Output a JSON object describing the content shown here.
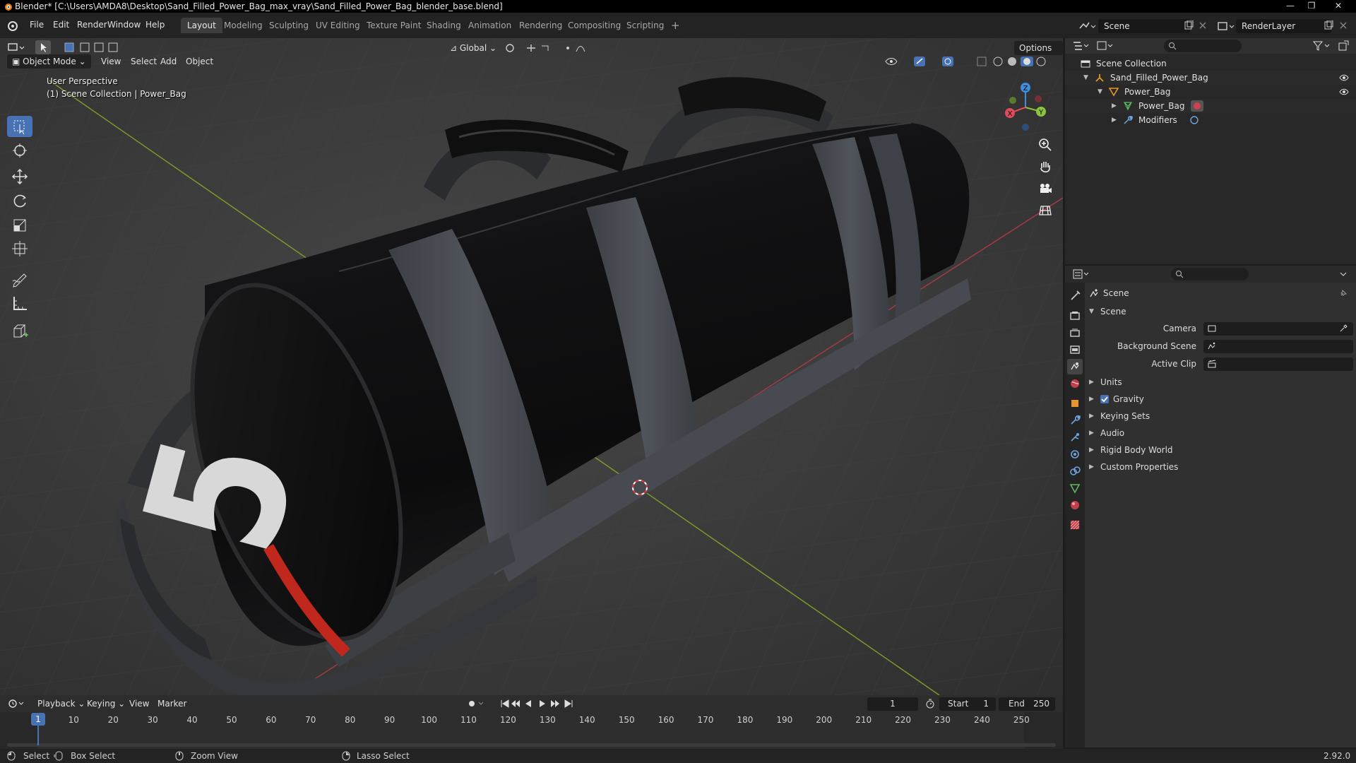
{
  "window": {
    "title": "Blender* [C:\\Users\\AMDA8\\Desktop\\Sand_Filled_Power_Bag_max_vray\\Sand_Filled_Power_Bag_blender_base.blend]",
    "minimize": "—",
    "maximize": "❐",
    "close": "✕"
  },
  "menu": [
    "File",
    "Edit",
    "Render",
    "Window",
    "Help"
  ],
  "workspaces": [
    {
      "label": "Layout",
      "active": true
    },
    {
      "label": "Modeling"
    },
    {
      "label": "Sculpting"
    },
    {
      "label": "UV Editing"
    },
    {
      "label": "Texture Paint"
    },
    {
      "label": "Shading"
    },
    {
      "label": "Animation"
    },
    {
      "label": "Rendering"
    },
    {
      "label": "Compositing"
    },
    {
      "label": "Scripting"
    }
  ],
  "add_workspace": "+",
  "scene_selector": {
    "value": "Scene"
  },
  "view_layer_selector": {
    "value": "RenderLayer"
  },
  "viewport": {
    "mode": "Object Mode",
    "menus": [
      "View",
      "Select",
      "Add",
      "Object"
    ],
    "orientation": "Global",
    "options": "Options",
    "overlay_line1": "User Perspective",
    "overlay_line2": "(1) Scene Collection | Power_Bag",
    "gizmo": {
      "x": "X",
      "y": "Y",
      "z": "Z"
    },
    "bag_number": "5"
  },
  "outliner": {
    "root": "Scene Collection",
    "items": [
      {
        "label": "Sand_Filled_Power_Bag",
        "level": 1
      },
      {
        "label": "Power_Bag",
        "level": 2
      },
      {
        "label": "Power_Bag",
        "level": 3
      },
      {
        "label": "Modifiers",
        "level": 3
      }
    ]
  },
  "properties": {
    "context_title": "Scene",
    "panel_title": "Scene",
    "fields": [
      {
        "label": "Camera"
      },
      {
        "label": "Background Scene"
      },
      {
        "label": "Active Clip"
      }
    ],
    "sections": [
      "Units",
      "Gravity",
      "Keying Sets",
      "Audio",
      "Rigid Body World",
      "Custom Properties"
    ]
  },
  "timeline": {
    "menus": [
      "Playback",
      "Keying",
      "View",
      "Marker"
    ],
    "current_frame": "1",
    "start_label": "Start",
    "start": "1",
    "end_label": "End",
    "end": "250",
    "ruler": [
      "1",
      "10",
      "20",
      "30",
      "40",
      "50",
      "60",
      "70",
      "80",
      "90",
      "100",
      "110",
      "120",
      "130",
      "140",
      "150",
      "160",
      "170",
      "180",
      "190",
      "200",
      "210",
      "220",
      "230",
      "240",
      "250"
    ]
  },
  "statusbar": {
    "select": "Select",
    "box_select": "Box Select",
    "zoom_view": "Zoom View",
    "lasso_select": "Lasso Select",
    "version": "2.92.0"
  },
  "colors": {
    "accent": "#4772b3",
    "x_axis": "#e24b5e",
    "y_axis": "#8bc43a",
    "z_axis": "#3d8fe0"
  }
}
